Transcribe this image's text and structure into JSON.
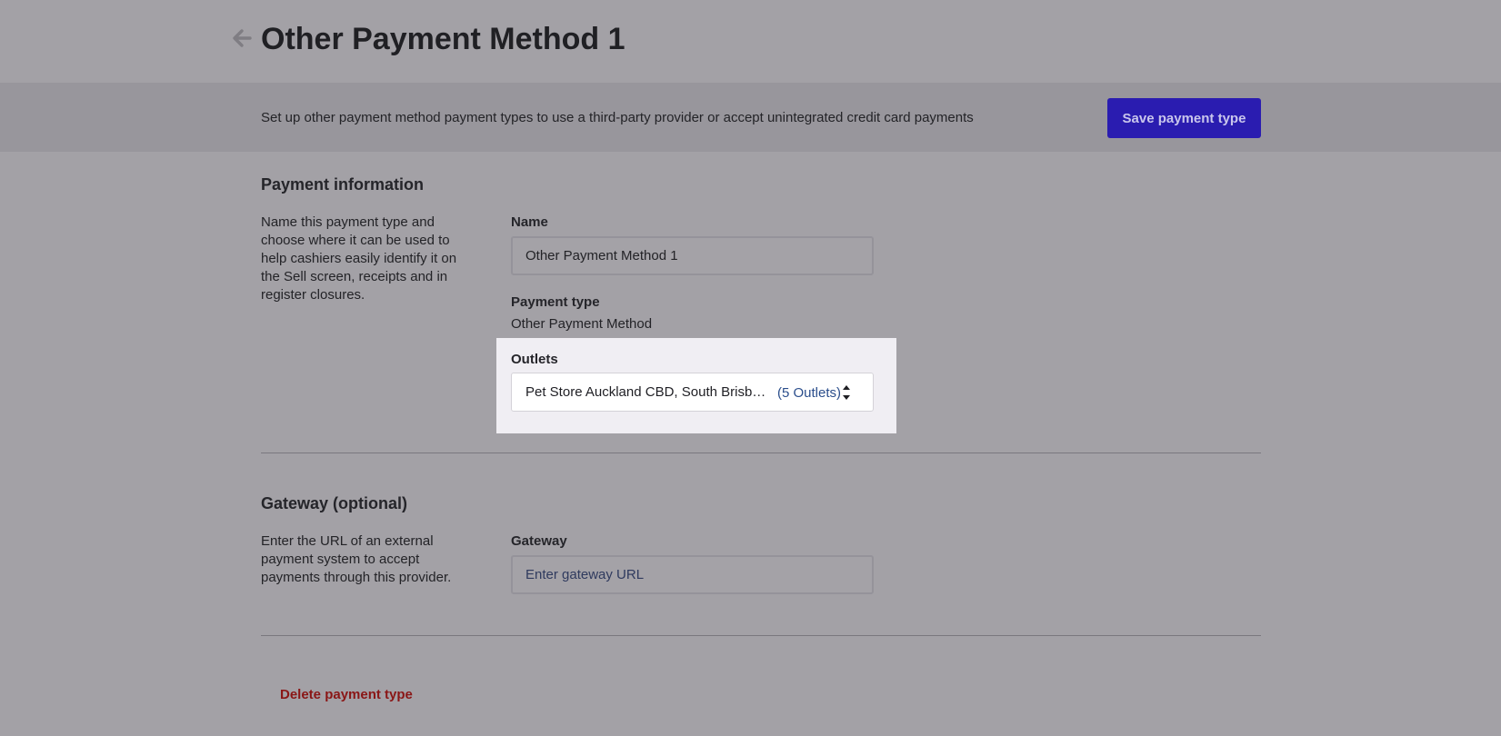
{
  "header": {
    "title": "Other Payment Method 1",
    "back_icon": "arrow-left-icon"
  },
  "banner": {
    "description": "Set up other payment method payment types to use a third-party provider or accept unintegrated credit card payments",
    "save_label": "Save payment type"
  },
  "payment_information": {
    "title": "Payment information",
    "description": "Name this payment type and choose where it can be used to help cashiers easily identify it on the Sell screen, receipts and in register closures.",
    "name_label": "Name",
    "name_value": "Other Payment Method 1",
    "payment_type_label": "Payment type",
    "payment_type_value": "Other Payment Method",
    "outlets_label": "Outlets",
    "outlets_value": "Pet Store Auckland CBD, South Brisbane, Sydney Central, Wellington, Melbourne",
    "outlets_count": "(5 Outlets)",
    "outlets_icon": "up-down-chevron-icon"
  },
  "gateway": {
    "title": "Gateway (optional)",
    "description": "Enter the URL of an external payment system to accept payments through this provider.",
    "gateway_label": "Gateway",
    "gateway_placeholder": "Enter gateway URL",
    "gateway_value": ""
  },
  "footer": {
    "delete_label": "Delete payment type"
  },
  "colors": {
    "primary_button": "#2a1cb0",
    "danger_text": "#8a1616",
    "link_text": "#2b4e8c",
    "overlay_background": "#a3a1a6",
    "highlight_panel": "#f0eef3"
  }
}
